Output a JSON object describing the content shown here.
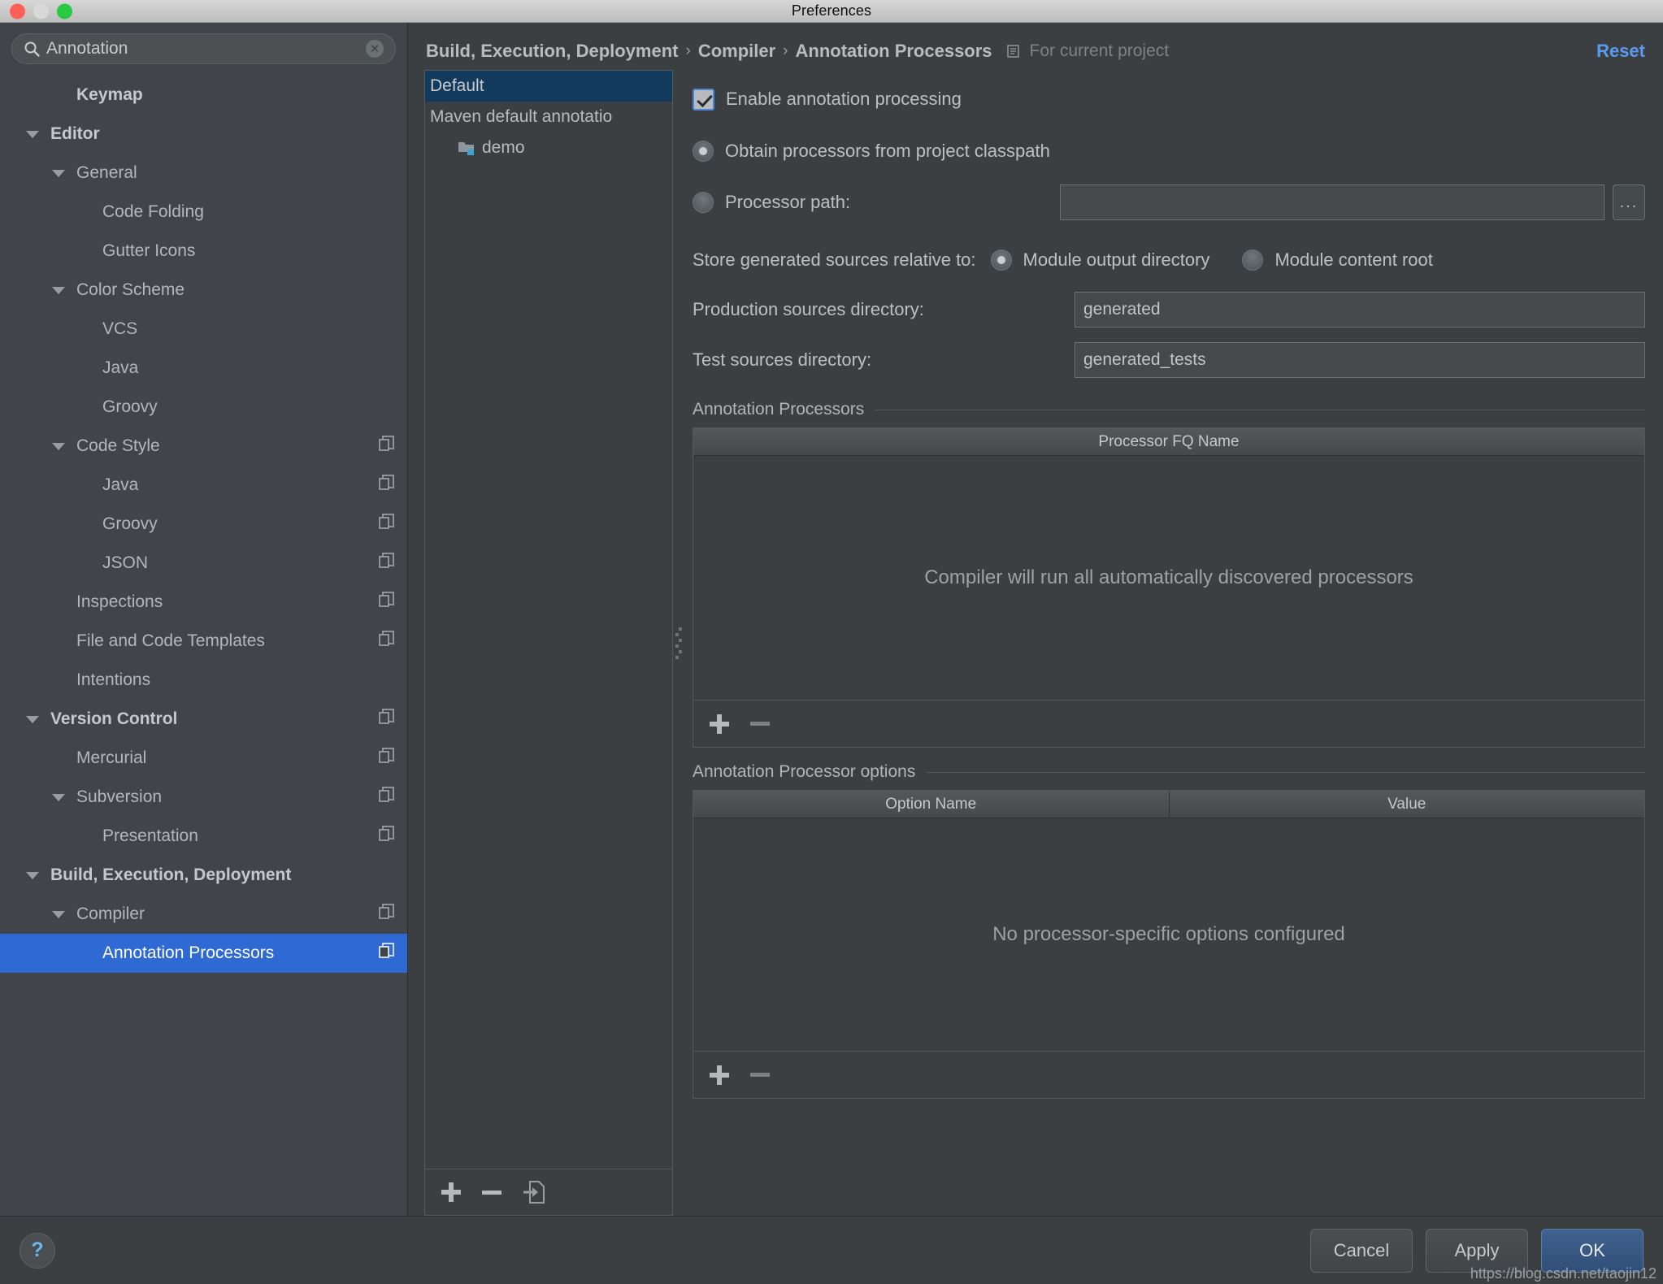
{
  "window": {
    "title": "Preferences",
    "traffic_lights": [
      "close-red",
      "minimize-gray",
      "zoom-green"
    ]
  },
  "sidebar": {
    "search": {
      "value": "Annotation",
      "placeholder": "Search settings",
      "icon": "search-icon",
      "clear_icon": "clear-icon"
    },
    "items": [
      {
        "label": "Keymap",
        "depth": 1,
        "bold": true,
        "arrow": "none",
        "copy": false,
        "selected": false
      },
      {
        "label": "Editor",
        "depth": 0,
        "bold": true,
        "arrow": "down",
        "copy": false,
        "selected": false
      },
      {
        "label": "General",
        "depth": 1,
        "bold": false,
        "arrow": "down",
        "copy": false,
        "selected": false
      },
      {
        "label": "Code Folding",
        "depth": 2,
        "bold": false,
        "arrow": "none",
        "copy": false,
        "selected": false
      },
      {
        "label": "Gutter Icons",
        "depth": 2,
        "bold": false,
        "arrow": "none",
        "copy": false,
        "selected": false
      },
      {
        "label": "Color Scheme",
        "depth": 1,
        "bold": false,
        "arrow": "down",
        "copy": false,
        "selected": false
      },
      {
        "label": "VCS",
        "depth": 2,
        "bold": false,
        "arrow": "none",
        "copy": false,
        "selected": false
      },
      {
        "label": "Java",
        "depth": 2,
        "bold": false,
        "arrow": "none",
        "copy": false,
        "selected": false
      },
      {
        "label": "Groovy",
        "depth": 2,
        "bold": false,
        "arrow": "none",
        "copy": false,
        "selected": false
      },
      {
        "label": "Code Style",
        "depth": 1,
        "bold": false,
        "arrow": "down",
        "copy": true,
        "selected": false
      },
      {
        "label": "Java",
        "depth": 2,
        "bold": false,
        "arrow": "none",
        "copy": true,
        "selected": false
      },
      {
        "label": "Groovy",
        "depth": 2,
        "bold": false,
        "arrow": "none",
        "copy": true,
        "selected": false
      },
      {
        "label": "JSON",
        "depth": 2,
        "bold": false,
        "arrow": "none",
        "copy": true,
        "selected": false
      },
      {
        "label": "Inspections",
        "depth": 1,
        "bold": false,
        "arrow": "none",
        "copy": true,
        "selected": false
      },
      {
        "label": "File and Code Templates",
        "depth": 1,
        "bold": false,
        "arrow": "none",
        "copy": true,
        "selected": false
      },
      {
        "label": "Intentions",
        "depth": 1,
        "bold": false,
        "arrow": "none",
        "copy": false,
        "selected": false
      },
      {
        "label": "Version Control",
        "depth": 0,
        "bold": true,
        "arrow": "down",
        "copy": true,
        "selected": false
      },
      {
        "label": "Mercurial",
        "depth": 1,
        "bold": false,
        "arrow": "none",
        "copy": true,
        "selected": false
      },
      {
        "label": "Subversion",
        "depth": 1,
        "bold": false,
        "arrow": "down",
        "copy": true,
        "selected": false
      },
      {
        "label": "Presentation",
        "depth": 2,
        "bold": false,
        "arrow": "none",
        "copy": true,
        "selected": false
      },
      {
        "label": "Build, Execution, Deployment",
        "depth": 0,
        "bold": true,
        "arrow": "down",
        "copy": false,
        "selected": false
      },
      {
        "label": "Compiler",
        "depth": 1,
        "bold": false,
        "arrow": "down",
        "copy": true,
        "selected": false
      },
      {
        "label": "Annotation Processors",
        "depth": 2,
        "bold": false,
        "arrow": "none",
        "copy": true,
        "selected": true
      }
    ]
  },
  "breadcrumb": {
    "parts": [
      "Build, Execution, Deployment",
      "Compiler",
      "Annotation Processors"
    ],
    "separator": "›",
    "scope_icon": "project-scope-icon",
    "scope_note": "For current project",
    "reset_label": "Reset"
  },
  "profiles": {
    "items": [
      {
        "label": "Default",
        "selected": true,
        "icon": "none",
        "indent": false
      },
      {
        "label": "Maven default annotatio",
        "selected": false,
        "icon": "none",
        "indent": false
      },
      {
        "label": "demo",
        "selected": false,
        "icon": "module-folder-icon",
        "indent": true
      }
    ],
    "toolbar": [
      {
        "name": "add-profile-button",
        "icon": "plus-icon"
      },
      {
        "name": "remove-profile-button",
        "icon": "minus-icon"
      },
      {
        "name": "move-to-profile-button",
        "icon": "move-module-icon"
      }
    ]
  },
  "settings": {
    "enable_processing": {
      "label": "Enable annotation processing",
      "checked": true
    },
    "source_mode": {
      "options": [
        {
          "label": "Obtain processors from project classpath",
          "selected": true
        },
        {
          "label": "Processor path:",
          "selected": false
        }
      ],
      "processor_path_value": "",
      "browse_label": "..."
    },
    "store_relative": {
      "label": "Store generated sources relative to:",
      "options": [
        {
          "label": "Module output directory",
          "selected": true
        },
        {
          "label": "Module content root",
          "selected": false
        }
      ]
    },
    "production_sources": {
      "label": "Production sources directory:",
      "value": "generated"
    },
    "test_sources": {
      "label": "Test sources directory:",
      "value": "generated_tests"
    },
    "processors_group": {
      "title": "Annotation Processors",
      "columns": [
        "Processor FQ Name"
      ],
      "rows": [],
      "empty_text": "Compiler will run all automatically discovered processors",
      "toolbar": [
        {
          "name": "add-processor-button",
          "icon": "plus-icon",
          "enabled": true
        },
        {
          "name": "remove-processor-button",
          "icon": "minus-icon",
          "enabled": false
        }
      ]
    },
    "options_group": {
      "title": "Annotation Processor options",
      "columns": [
        "Option Name",
        "Value"
      ],
      "rows": [],
      "empty_text": "No processor-specific options configured",
      "toolbar": [
        {
          "name": "add-option-button",
          "icon": "plus-icon",
          "enabled": true
        },
        {
          "name": "remove-option-button",
          "icon": "minus-icon",
          "enabled": false
        }
      ]
    }
  },
  "footer": {
    "help_label": "?",
    "buttons": [
      {
        "label": "Cancel",
        "primary": false
      },
      {
        "label": "Apply",
        "primary": false
      },
      {
        "label": "OK",
        "primary": true
      }
    ],
    "watermark": "https://blog.csdn.net/taojin12"
  },
  "colors": {
    "accent_selection": "#2f69d4",
    "link": "#5a9bf0",
    "window_bg": "#3c3f41",
    "sidebar_bg": "#41454a",
    "profile_selected": "#113a5c"
  }
}
